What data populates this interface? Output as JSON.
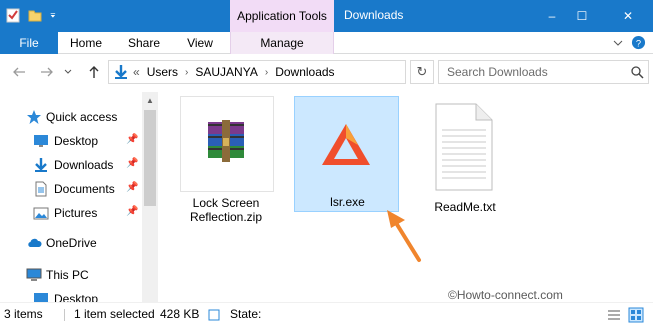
{
  "titlebar": {
    "context_tab_header": "Application Tools",
    "window_title": "Downloads",
    "minimize": "–",
    "maximize": "☐",
    "close": "✕"
  },
  "ribbon": {
    "tabs": [
      {
        "label": "File"
      },
      {
        "label": "Home"
      },
      {
        "label": "Share"
      },
      {
        "label": "View"
      },
      {
        "label": "Manage"
      }
    ],
    "expand_icon": "chevron-down-icon",
    "help_icon": "help-icon"
  },
  "address": {
    "overflow": "«",
    "crumbs": [
      "Users",
      "SAUJANYA",
      "Downloads"
    ],
    "search_placeholder": "Search Downloads"
  },
  "navpane": {
    "items": [
      {
        "label": "Quick access",
        "icon": "star-icon"
      },
      {
        "label": "Desktop",
        "icon": "desktop-icon",
        "pinned": true
      },
      {
        "label": "Downloads",
        "icon": "download-icon",
        "pinned": true
      },
      {
        "label": "Documents",
        "icon": "document-icon",
        "pinned": true
      },
      {
        "label": "Pictures",
        "icon": "pictures-icon",
        "pinned": true
      },
      {
        "label": "OneDrive",
        "icon": "cloud-icon"
      },
      {
        "label": "This PC",
        "icon": "computer-icon"
      },
      {
        "label": "Desktop",
        "icon": "desktop-icon"
      }
    ]
  },
  "files": [
    {
      "name": "Lock Screen Reflection.zip",
      "line1": "Lock Screen",
      "line2": "Reflection.zip",
      "icon": "winrar-archive-icon",
      "selected": false
    },
    {
      "name": "lsr.exe",
      "line1": "lsr.exe",
      "icon": "warning-triangle-app-icon",
      "selected": true
    },
    {
      "name": "ReadMe.txt",
      "line1": "ReadMe.txt",
      "icon": "text-file-icon",
      "selected": false
    }
  ],
  "status": {
    "count": "3 items",
    "selected": "1 item selected",
    "size": "428 KB",
    "state": "State:"
  },
  "watermark": "©Howto-connect.com",
  "colors": {
    "titlebar": "#1979ca",
    "context_tab": "#f2dcf6",
    "selection": "#cce8ff",
    "arrow": "#f0852d"
  }
}
